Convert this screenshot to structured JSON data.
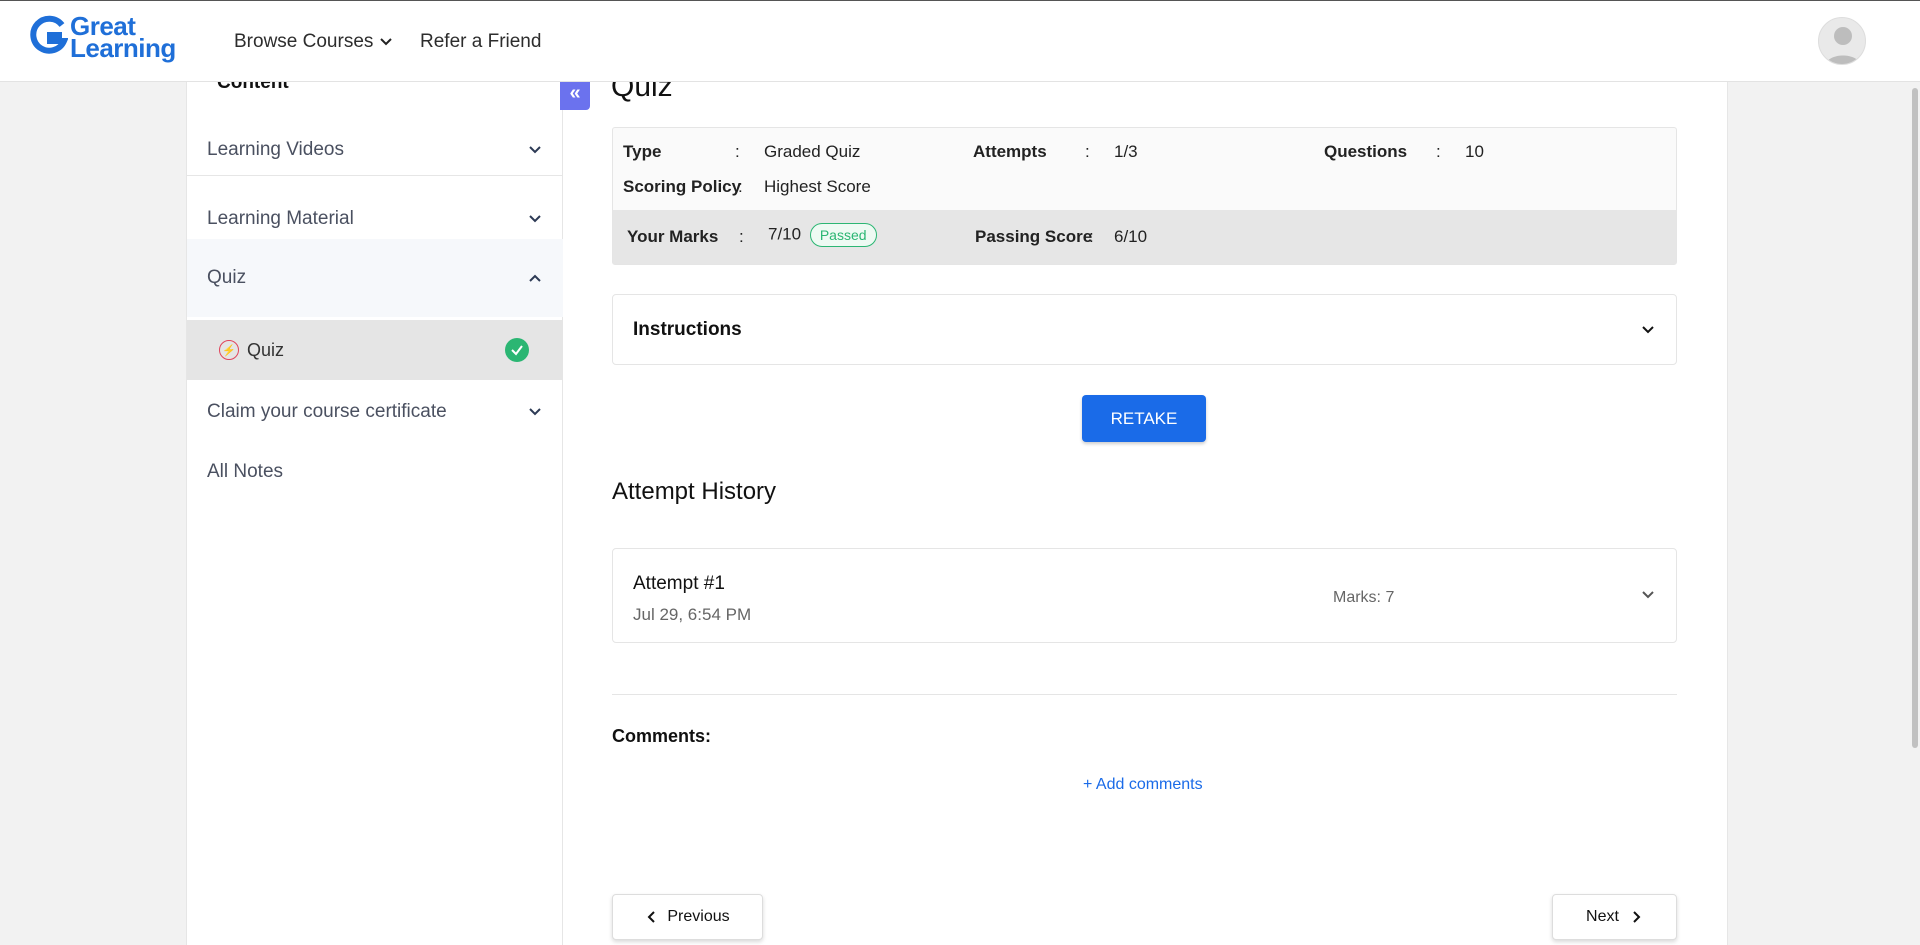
{
  "header": {
    "logo_line1": "Great",
    "logo_line2": "Learning",
    "nav": {
      "browse": "Browse Courses",
      "refer": "Refer a Friend"
    }
  },
  "sidebar": {
    "content_heading": "Content",
    "sections": {
      "videos": "Learning Videos",
      "material": "Learning Material",
      "quiz": "Quiz",
      "quiz_item": "Quiz",
      "claim": "Claim your course certificate",
      "notes": "All Notes"
    },
    "collapse_icon": "double-chevron-left-icon"
  },
  "quiz": {
    "title": "Quiz",
    "info": {
      "type_label": "Type",
      "type_value": "Graded Quiz",
      "attempts_label": "Attempts",
      "attempts_value": "1/3",
      "questions_label": "Questions",
      "questions_value": "10",
      "policy_label": "Scoring Policy",
      "policy_value": "Highest Score",
      "colon": ":",
      "marks_label": "Your Marks",
      "marks_value": "7/10",
      "status": "Passed",
      "passing_label": "Passing Score",
      "passing_value": "6/10"
    },
    "instructions": "Instructions",
    "retake": "RETAKE",
    "history_title": "Attempt History",
    "attempts": [
      {
        "name": "Attempt #1",
        "date": "Jul 29, 6:54 PM",
        "marks": "Marks: 7"
      }
    ],
    "comments_label": "Comments:",
    "add_comments": "+ Add comments",
    "prev": "Previous",
    "next": "Next"
  },
  "colors": {
    "brand_blue": "#1a6be8",
    "passed_green": "#2bb673",
    "collapse_purple": "#6b72ee"
  }
}
